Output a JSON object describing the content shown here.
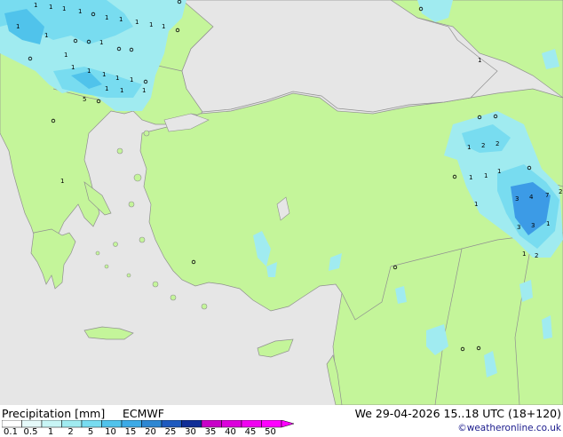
{
  "footer": {
    "title": "Precipitation [mm]",
    "model": "ECMWF",
    "datetime": "We 29-04-2026 15..18 UTC (18+120)",
    "copyright": "©weatheronline.co.uk"
  },
  "legend": {
    "ticks": [
      "0.1",
      "0.5",
      "1",
      "2",
      "5",
      "10",
      "15",
      "20",
      "25",
      "30",
      "35",
      "40",
      "45",
      "50"
    ],
    "colors": [
      "#ffffff",
      "#e6fafa",
      "#c8f5f5",
      "#a0ebf0",
      "#78dcf0",
      "#50c3eb",
      "#3caae6",
      "#2d87d2",
      "#1e5abe",
      "#0f2d96",
      "#c800c8",
      "#dc00dc",
      "#f000f0",
      "#ff00ff"
    ]
  },
  "map_colors": {
    "sea": "#e6e6e6",
    "land": "#c4f59a",
    "border": "#909090",
    "rain_light": "#a0ebf0",
    "rain_medium": "#78dcf0",
    "rain_heavy": "#50c3eb",
    "rain_max": "#3c9be6"
  },
  "map_labels": {
    "l01": "1",
    "l02": "1",
    "l03": "1",
    "l04": "1",
    "l05": "1",
    "l06": "1",
    "l07": "1",
    "l08": "1",
    "l09": "1",
    "l10": "1",
    "l11": "1",
    "l12": "1",
    "l13": "1",
    "l14": "1",
    "l15": "1",
    "l16": "1",
    "l17": "2",
    "l18": "2",
    "l19": "1",
    "l20": "1",
    "l21": "1",
    "l22": "3",
    "l23": "4",
    "l24": "7",
    "l25": "2",
    "l26": "3",
    "l27": "3",
    "l28": "1",
    "l29": "1",
    "l30": "2",
    "l31": "1",
    "l32": "5",
    "l33": "1",
    "l34": "1",
    "l35": "1",
    "l36": "1",
    "l37": "1",
    "l38": "1",
    "l39": "1",
    "l40": "1"
  }
}
